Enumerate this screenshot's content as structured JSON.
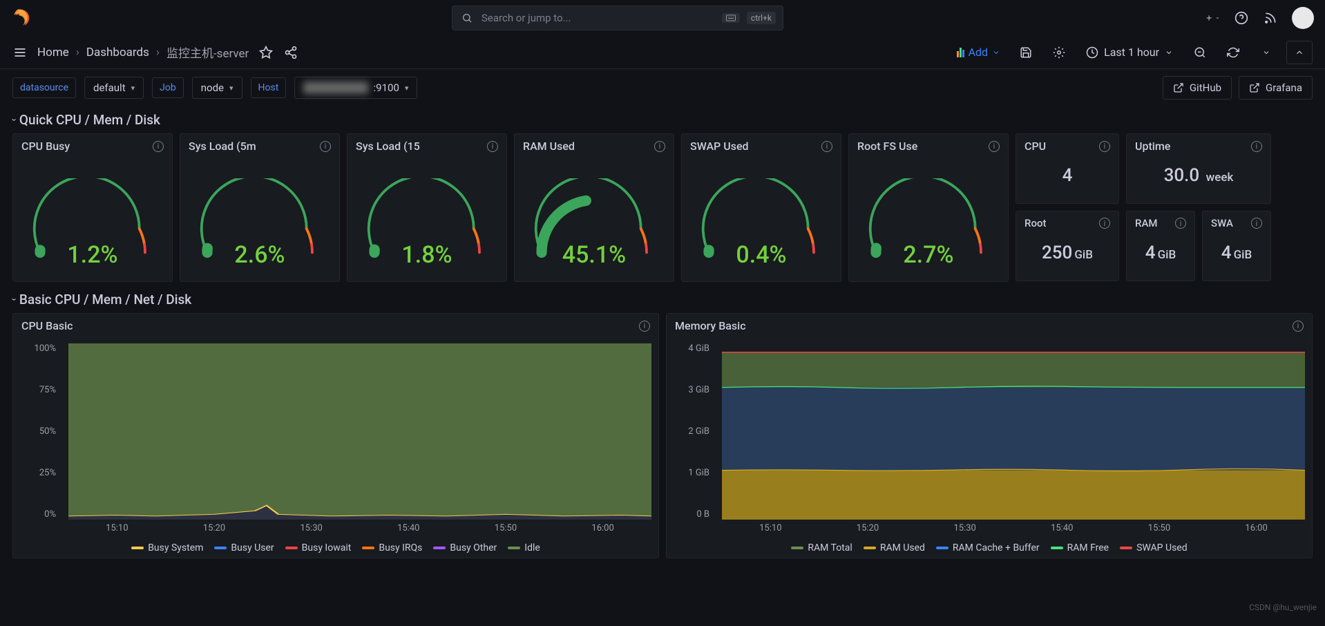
{
  "search": {
    "placeholder": "Search or jump to...",
    "shortcut": "ctrl+k"
  },
  "breadcrumbs": {
    "home": "Home",
    "dashboards": "Dashboards",
    "current": "监控主机-server"
  },
  "toolbar": {
    "add_label": "Add",
    "time_range": "Last 1 hour"
  },
  "vars": {
    "datasource_label": "datasource",
    "datasource_value": "default",
    "job_label": "Job",
    "job_value": "node",
    "host_label": "Host",
    "host_value": ":9100"
  },
  "links": {
    "github": "GitHub",
    "grafana": "Grafana"
  },
  "rows": {
    "quick": "Quick CPU / Mem / Disk",
    "basic": "Basic CPU / Mem / Net / Disk"
  },
  "gauges": {
    "cpu_busy": {
      "title": "CPU Busy",
      "value": "1.2%",
      "pct": 1.2
    },
    "sys_load_5": {
      "title": "Sys Load (5m",
      "value": "2.6%",
      "pct": 2.6
    },
    "sys_load_15": {
      "title": "Sys Load (15",
      "value": "1.8%",
      "pct": 1.8
    },
    "ram_used": {
      "title": "RAM Used",
      "value": "45.1%",
      "pct": 45.1
    },
    "swap_used": {
      "title": "SWAP Used",
      "value": "0.4%",
      "pct": 0.4
    },
    "root_fs": {
      "title": "Root FS Use",
      "value": "2.7%",
      "pct": 2.7
    }
  },
  "stats": {
    "cpu": {
      "title": "CPU",
      "value": "4",
      "unit": ""
    },
    "uptime": {
      "title": "Uptime",
      "value": "30.0",
      "unit": "week"
    },
    "root": {
      "title": "Root",
      "value": "250",
      "unit": "GiB"
    },
    "ram": {
      "title": "RAM",
      "value": "4",
      "unit": "GiB"
    },
    "swap": {
      "title": "SWA",
      "value": "4",
      "unit": "GiB"
    }
  },
  "charts": {
    "cpu_basic": {
      "title": "CPU Basic",
      "y_ticks": [
        "100%",
        "75%",
        "50%",
        "25%",
        "0%"
      ],
      "x_ticks": [
        "15:10",
        "15:20",
        "15:30",
        "15:40",
        "15:50",
        "16:00"
      ],
      "legend": [
        {
          "label": "Busy System",
          "color": "#f2c94c"
        },
        {
          "label": "Busy User",
          "color": "#3b82f6"
        },
        {
          "label": "Busy Iowait",
          "color": "#ef4444"
        },
        {
          "label": "Busy IRQs",
          "color": "#f97316"
        },
        {
          "label": "Busy Other",
          "color": "#a855f7"
        },
        {
          "label": "Idle",
          "color": "#6b8e4e"
        }
      ]
    },
    "memory_basic": {
      "title": "Memory Basic",
      "y_ticks": [
        "4 GiB",
        "3 GiB",
        "2 GiB",
        "1 GiB",
        "0 B"
      ],
      "x_ticks": [
        "15:10",
        "15:20",
        "15:30",
        "15:40",
        "15:50",
        "16:00"
      ],
      "legend": [
        {
          "label": "RAM Total",
          "color": "#6b8e4e"
        },
        {
          "label": "RAM Used",
          "color": "#d4a82a"
        },
        {
          "label": "RAM Cache + Buffer",
          "color": "#3b82f6"
        },
        {
          "label": "RAM Free",
          "color": "#4ade80"
        },
        {
          "label": "SWAP Used",
          "color": "#ef4444"
        }
      ]
    }
  },
  "watermark": "CSDN @hu_wenjie",
  "chart_data": [
    {
      "type": "area",
      "title": "CPU Basic",
      "xlabel": "",
      "ylabel": "",
      "ylim": [
        0,
        100
      ],
      "x": [
        "15:10",
        "15:20",
        "15:30",
        "15:40",
        "15:50",
        "16:00"
      ],
      "series": [
        {
          "name": "Idle",
          "values": [
            98,
            98,
            97,
            98,
            98,
            98
          ]
        },
        {
          "name": "Busy System",
          "values": [
            1,
            1,
            1.5,
            1,
            1,
            1
          ]
        },
        {
          "name": "Busy User",
          "values": [
            0.5,
            0.5,
            1,
            0.5,
            0.5,
            0.5
          ]
        },
        {
          "name": "Busy Iowait",
          "values": [
            0.2,
            0.2,
            0.2,
            0.2,
            0.2,
            0.2
          ]
        },
        {
          "name": "Busy IRQs",
          "values": [
            0.1,
            0.1,
            0.1,
            0.1,
            0.1,
            0.1
          ]
        },
        {
          "name": "Busy Other",
          "values": [
            0.2,
            0.2,
            0.2,
            0.2,
            0.2,
            0.2
          ]
        }
      ]
    },
    {
      "type": "area",
      "title": "Memory Basic",
      "xlabel": "",
      "ylabel": "",
      "ylim": [
        0,
        4
      ],
      "y_unit": "GiB",
      "x": [
        "15:10",
        "15:20",
        "15:30",
        "15:40",
        "15:50",
        "16:00"
      ],
      "series": [
        {
          "name": "RAM Total",
          "values": [
            3.8,
            3.8,
            3.8,
            3.8,
            3.8,
            3.8
          ]
        },
        {
          "name": "RAM Used",
          "values": [
            1.1,
            1.1,
            1.1,
            1.1,
            1.1,
            1.1
          ]
        },
        {
          "name": "RAM Cache + Buffer",
          "values": [
            1.9,
            1.9,
            1.9,
            1.9,
            1.9,
            1.9
          ]
        },
        {
          "name": "RAM Free",
          "values": [
            0.8,
            0.8,
            0.8,
            0.8,
            0.8,
            0.8
          ]
        },
        {
          "name": "SWAP Used",
          "values": [
            0.02,
            0.02,
            0.02,
            0.02,
            0.02,
            0.02
          ]
        }
      ]
    }
  ]
}
